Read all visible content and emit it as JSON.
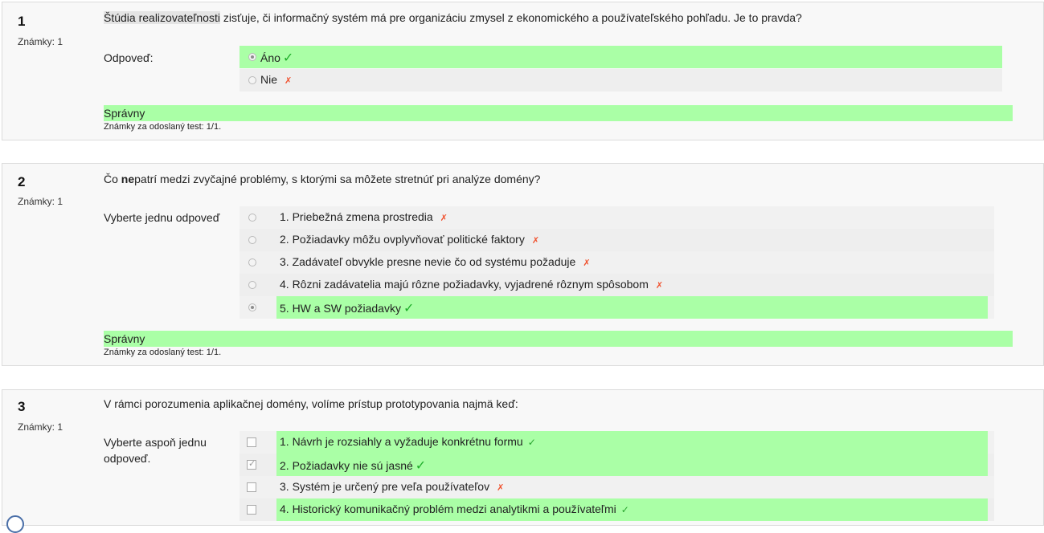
{
  "questions": [
    {
      "number": "1",
      "marks": "Známky: 1",
      "text_highlight": "Štúdia realizovateľnosti",
      "text_rest": " zisťuje, či informačný systém má pre organizáciu zmysel z ekonomického a používateľského pohľadu. Je to pravda?",
      "prompt": "Odpoveď:",
      "options": [
        {
          "label": "Áno",
          "selected": true,
          "mark": "✓"
        },
        {
          "label": "Nie",
          "selected": false,
          "mark": "✗"
        }
      ],
      "result": "Správny",
      "grade": "Známky za odoslaný test: 1/1."
    },
    {
      "number": "2",
      "marks": "Známky: 1",
      "text_pre": "Čo ",
      "text_bold": "ne",
      "text_rest": "patrí medzi zvyčajné problémy, s ktorými sa môžete stretnúť pri analýze domény?",
      "prompt": "Vyberte jednu odpoveď",
      "options": [
        {
          "label": "1. Priebežná zmena prostredia",
          "selected": false,
          "mark": "✗"
        },
        {
          "label": "2. Požiadavky môžu ovplyvňovať politické faktory",
          "selected": false,
          "mark": "✗"
        },
        {
          "label": "3. Zadávateľ obvykle presne nevie čo od systému požaduje",
          "selected": false,
          "mark": "✗"
        },
        {
          "label": "4. Rôzni zadávatelia majú rôzne požiadavky, vyjadrené rôznym spôsobom",
          "selected": false,
          "mark": "✗"
        },
        {
          "label": "5. HW a SW požiadavky",
          "selected": true,
          "mark": "✓"
        }
      ],
      "result": "Správny",
      "grade": "Známky za odoslaný test: 1/1."
    },
    {
      "number": "3",
      "marks": "Známky: 1",
      "text": "V rámci porozumenia aplikačnej domény, volíme prístup prototypovania najmä keď:",
      "prompt_line1": "Vyberte aspoň jednu",
      "prompt_line2": "odpoveď.",
      "options": [
        {
          "label": "1. Návrh je rozsiahly a vyžaduje konkrétnu formu",
          "selected": false,
          "mark": "✓"
        },
        {
          "label": "2. Požiadavky nie sú jasné",
          "selected": true,
          "mark": "✓"
        },
        {
          "label": "3. Systém je určený pre veľa používateľov",
          "selected": false,
          "mark": "✗"
        },
        {
          "label": "4. Historický komunikačný problém medzi analytikmi a používateľmi",
          "selected": false,
          "mark": "✓"
        }
      ]
    }
  ],
  "colors": {
    "correct_bg": "#aaffa6",
    "option_bg": "#eeeeee",
    "tick": "#1fae2a",
    "cross": "#f0522f"
  }
}
